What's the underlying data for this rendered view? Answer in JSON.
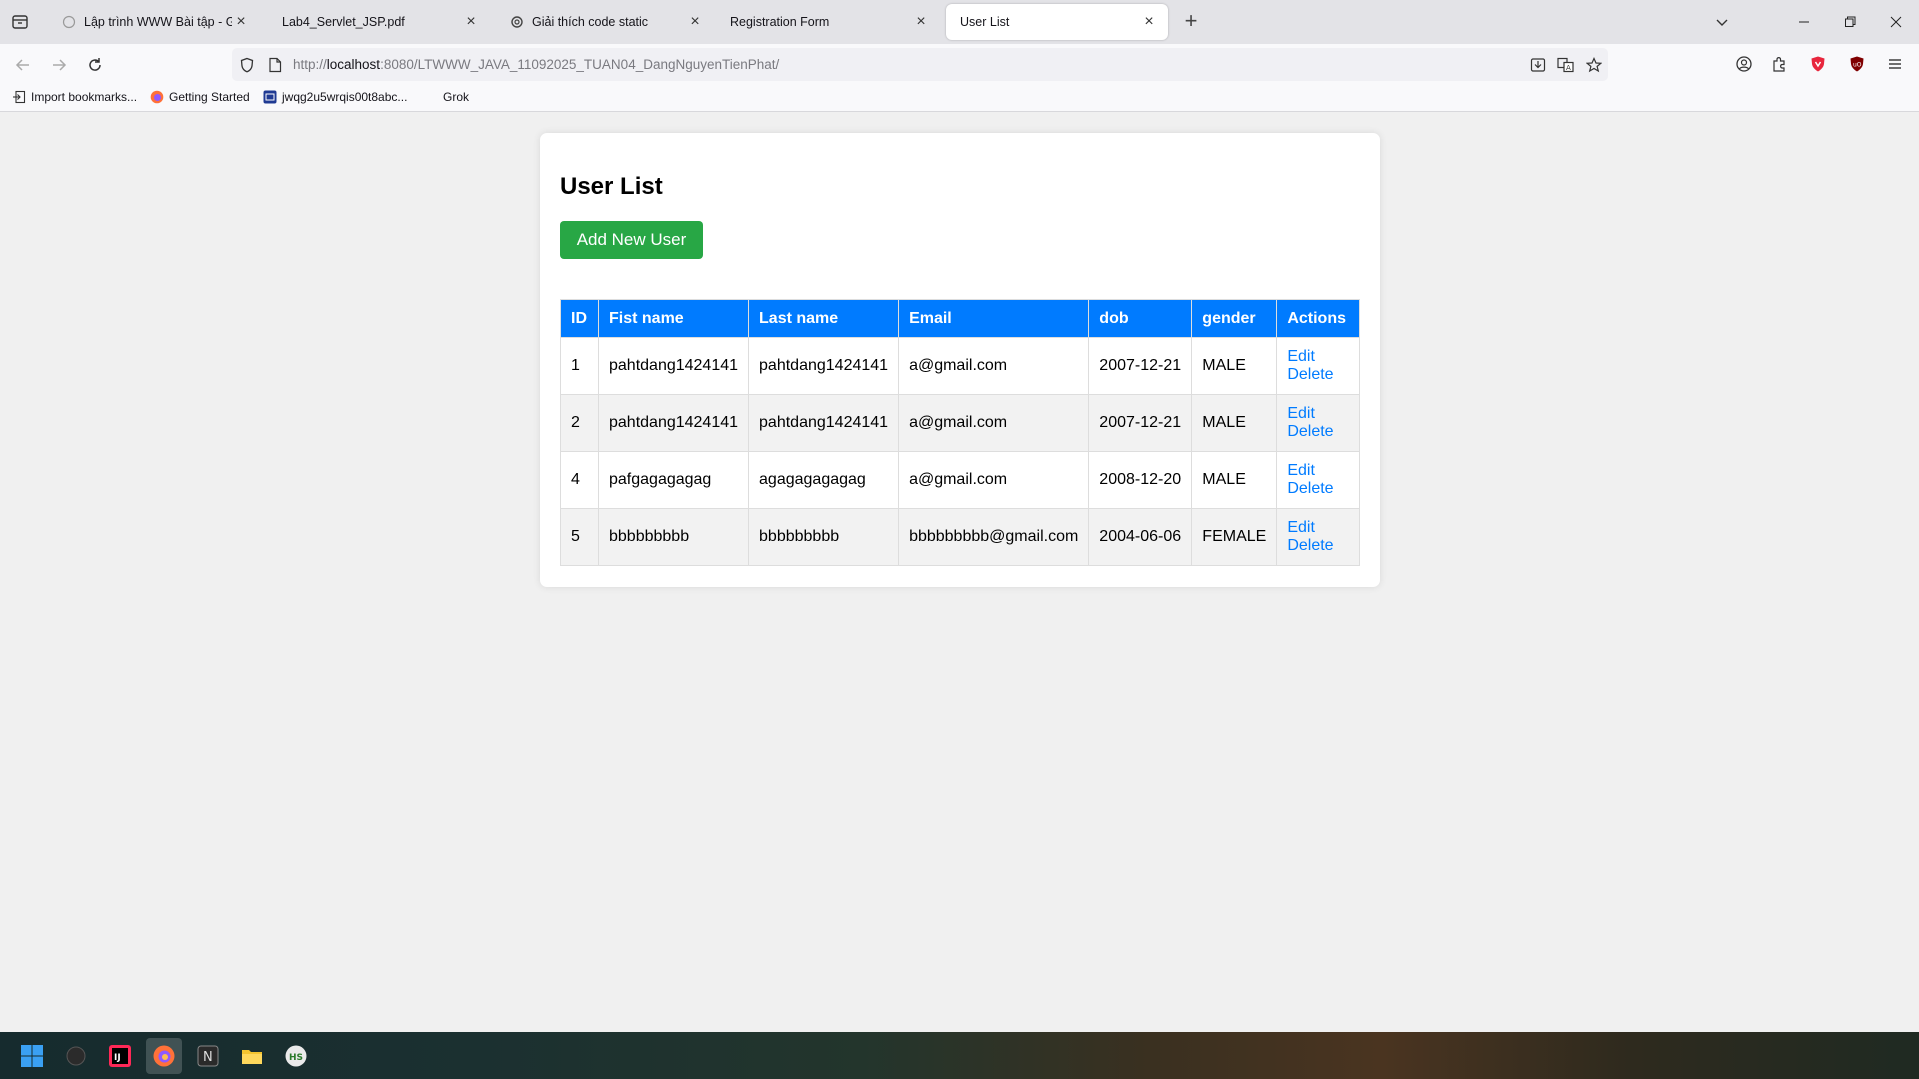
{
  "browser": {
    "tabs": [
      {
        "title": "Lập trình WWW Bài tập - Grok",
        "active": false
      },
      {
        "title": "Lab4_Servlet_JSP.pdf",
        "active": false
      },
      {
        "title": "Giải thích code static",
        "active": false
      },
      {
        "title": "Registration Form",
        "active": false
      },
      {
        "title": "User List",
        "active": true
      }
    ],
    "url": {
      "scheme": "http://",
      "host": "localhost",
      "rest": ":8080/LTWWW_JAVA_11092025_TUAN04_DangNguyenTienPhat/"
    },
    "bookmarks": [
      {
        "label": "Import bookmarks...",
        "icon": "import-icon"
      },
      {
        "label": "Getting Started",
        "icon": "firefox-icon"
      },
      {
        "label": "jwqg2u5wrqis00t8abc...",
        "icon": "site-icon"
      },
      {
        "label": "Grok",
        "icon": "grok-icon"
      }
    ]
  },
  "page": {
    "title": "User List",
    "add_button": "Add New User",
    "columns": [
      "ID",
      "Fist name",
      "Last name",
      "Email",
      "dob",
      "gender",
      "Actions"
    ],
    "rows": [
      {
        "id": "1",
        "first": "pahtdang1424141",
        "last": "pahtdang1424141",
        "email": "a@gmail.com",
        "dob": "2007-12-21",
        "gender": "MALE",
        "edit": "Edit",
        "delete": "Delete"
      },
      {
        "id": "2",
        "first": "pahtdang1424141",
        "last": "pahtdang1424141",
        "email": "a@gmail.com",
        "dob": "2007-12-21",
        "gender": "MALE",
        "edit": "Edit",
        "delete": "Delete"
      },
      {
        "id": "4",
        "first": "pafgagagagag",
        "last": "agagagagagag",
        "email": "a@gmail.com",
        "dob": "2008-12-20",
        "gender": "MALE",
        "edit": "Edit",
        "delete": "Delete"
      },
      {
        "id": "5",
        "first": "bbbbbbbbb",
        "last": "bbbbbbbbb",
        "email": "bbbbbbbbb@gmail.com",
        "dob": "2004-06-06",
        "gender": "FEMALE",
        "edit": "Edit",
        "delete": "Delete"
      }
    ]
  },
  "colors": {
    "header_bg": "#007bff",
    "add_button_bg": "#28a745",
    "link": "#007bff"
  },
  "taskbar": {
    "apps": [
      "windows-start-icon",
      "search-icon",
      "intellij-icon",
      "firefox-icon",
      "notion-icon",
      "file-explorer-icon",
      "hs-app-icon"
    ]
  }
}
